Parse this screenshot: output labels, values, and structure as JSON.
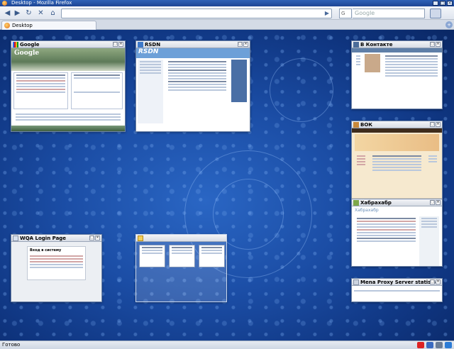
{
  "window": {
    "title": "Desktop - Mozilla Firefox"
  },
  "toolbar": {
    "url_value": "",
    "search_placeholder": "Google",
    "search_engine": "G"
  },
  "tabs": [
    {
      "label": "Desktop",
      "active": true
    }
  ],
  "tab_groups": [
    {
      "title": "Google",
      "favicon": "google-icon"
    },
    {
      "title": "RSDN",
      "favicon": "rsdn-icon"
    },
    {
      "title": "В Контакте",
      "favicon": "vkontakte-icon"
    },
    {
      "title": "ВОК",
      "favicon": "vok-icon"
    },
    {
      "title": "Хабрахабр",
      "favicon": "habr-icon"
    },
    {
      "title": "WQA Login Page",
      "favicon": "wqa-icon"
    },
    {
      "title": "",
      "favicon": "folder-icon"
    },
    {
      "title": "Mena Proxy Server statistics",
      "favicon": "page-icon"
    }
  ],
  "thumb_text": {
    "google_brand": "Google",
    "rsdn_brand": "RSDN",
    "habr_brand": "Хабрахабр",
    "wqa_heading": "Вход в систему"
  },
  "status": {
    "text": "Готово"
  },
  "colors": {
    "accent": "#1d4594",
    "desktop": "#1b4da5"
  }
}
